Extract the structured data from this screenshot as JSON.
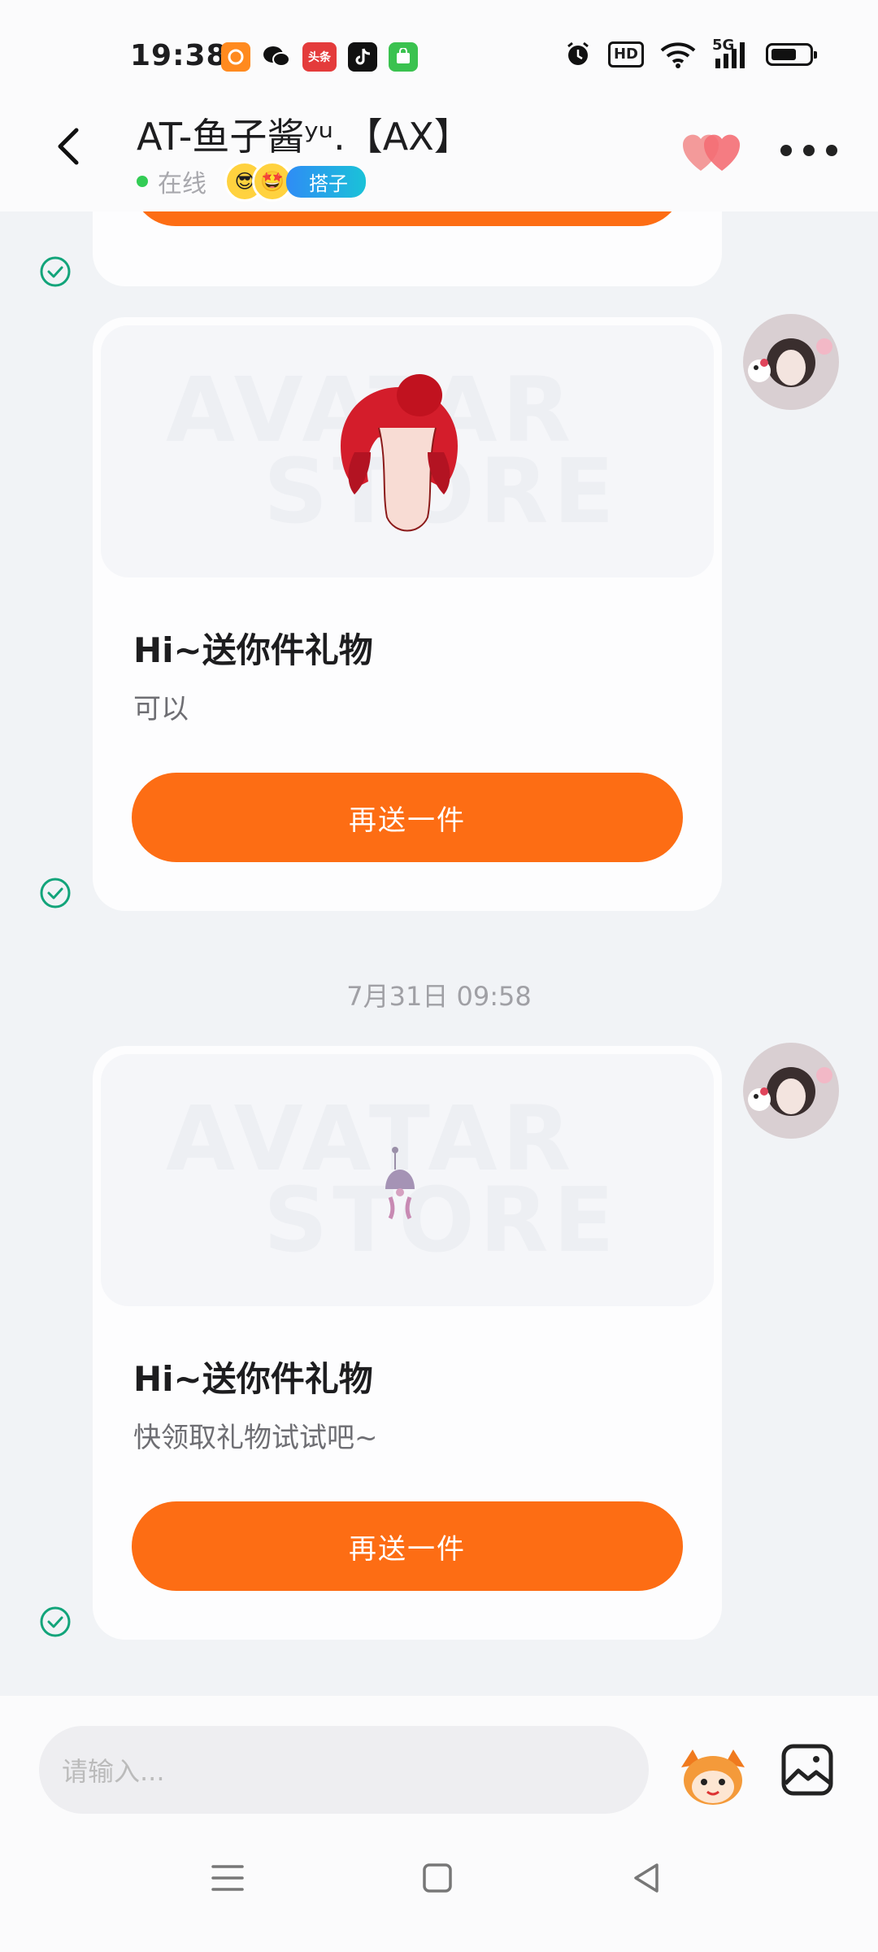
{
  "status_bar": {
    "time": "19:38",
    "app_icons": [
      "orange-app-icon",
      "wechat-icon",
      "toutiao-icon",
      "tiktok-icon",
      "green-app-icon"
    ],
    "toutiao_label": "头条",
    "hd": "HD",
    "network": "5G"
  },
  "header": {
    "title": "AT-鱼子酱ʸᵘ.【AX】",
    "online_status": "在线",
    "partner_tag": "搭子"
  },
  "messages": [
    {
      "type": "gift",
      "title": "Hi~送你件礼物",
      "description": "可以",
      "button_label": "再送一件",
      "watermark_line1": "AVATAR",
      "watermark_line2": "STORE",
      "gift_item": "red-hair-icon"
    },
    {
      "type": "gift",
      "title": "Hi~送你件礼物",
      "description": "快领取礼物试试吧~",
      "button_label": "再送一件",
      "watermark_line1": "AVATAR",
      "watermark_line2": "STORE",
      "gift_item": "small-accessory-icon"
    }
  ],
  "timestamp": "7月31日 09:58",
  "input": {
    "placeholder": "请输入..."
  },
  "colors": {
    "accent": "#fd6d14",
    "check": "#12a47a",
    "online": "#33cc55",
    "background": "#f1f3f6"
  }
}
